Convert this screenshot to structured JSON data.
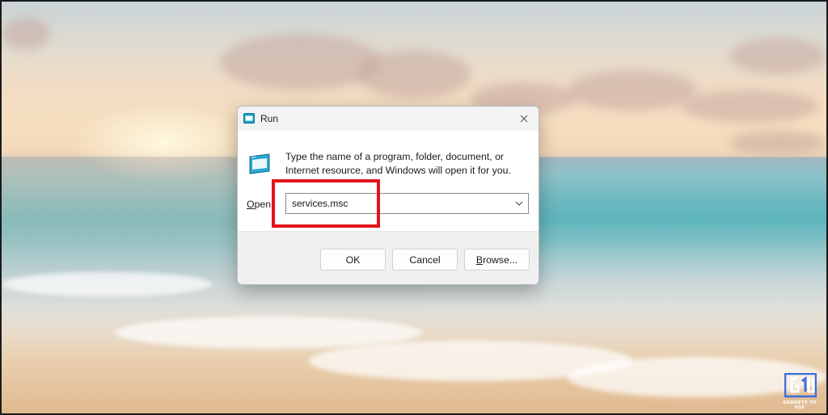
{
  "dialog": {
    "title": "Run",
    "description": "Type the name of a program, folder, document, or Internet resource, and Windows will open it for you.",
    "open_label": "Open:",
    "open_value": "services.msc",
    "buttons": {
      "ok": "OK",
      "cancel": "Cancel",
      "browse": "Browse..."
    },
    "icons": {
      "title": "run-icon",
      "close": "close-icon",
      "dropdown": "chevron-down-icon"
    }
  },
  "annotation": {
    "highlight_color": "#e3141b",
    "target": "services.msc"
  },
  "watermark": {
    "text": "GADGETS TO USE"
  }
}
